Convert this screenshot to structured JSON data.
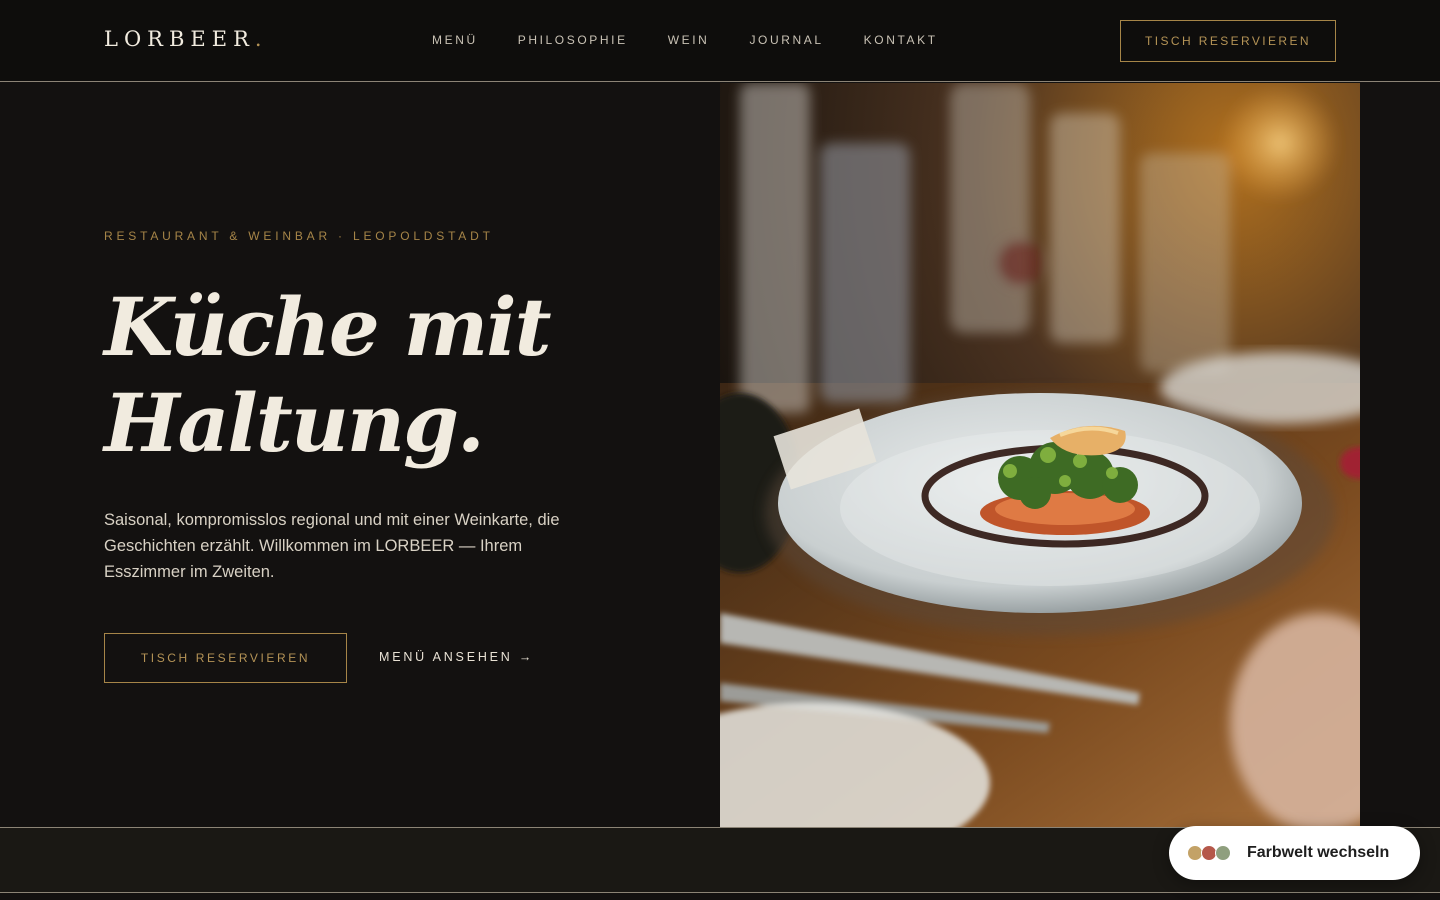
{
  "brand": {
    "name": "LORBEER",
    "dot": "."
  },
  "nav": {
    "items": [
      {
        "label": "MENÜ"
      },
      {
        "label": "PHILOSOPHIE"
      },
      {
        "label": "WEIN"
      },
      {
        "label": "JOURNAL"
      },
      {
        "label": "KONTAKT"
      }
    ],
    "cta_label": "TISCH RESERVIEREN"
  },
  "hero": {
    "eyebrow": "RESTAURANT & WEINBAR · LEOPOLDSTADT",
    "headline_line1": "Küche mit",
    "headline_line2": "Haltung.",
    "intro": "Saisonal, kompromisslos regional und mit einer Weinkarte, die Geschichten erzählt. Willkommen im LORBEER — Ihrem Esszimmer im Zweiten.",
    "primary_cta": "TISCH RESERVIEREN",
    "secondary_cta": "MENÜ ANSEHEN →"
  },
  "theme_switcher": {
    "label": "Farbwelt wechseln",
    "swatches": [
      "#c3a267",
      "#b5584a",
      "#8f9f7e"
    ]
  },
  "colors": {
    "background": "#131110",
    "accent_gold": "#b49356",
    "text_light": "#f1ebdf"
  }
}
